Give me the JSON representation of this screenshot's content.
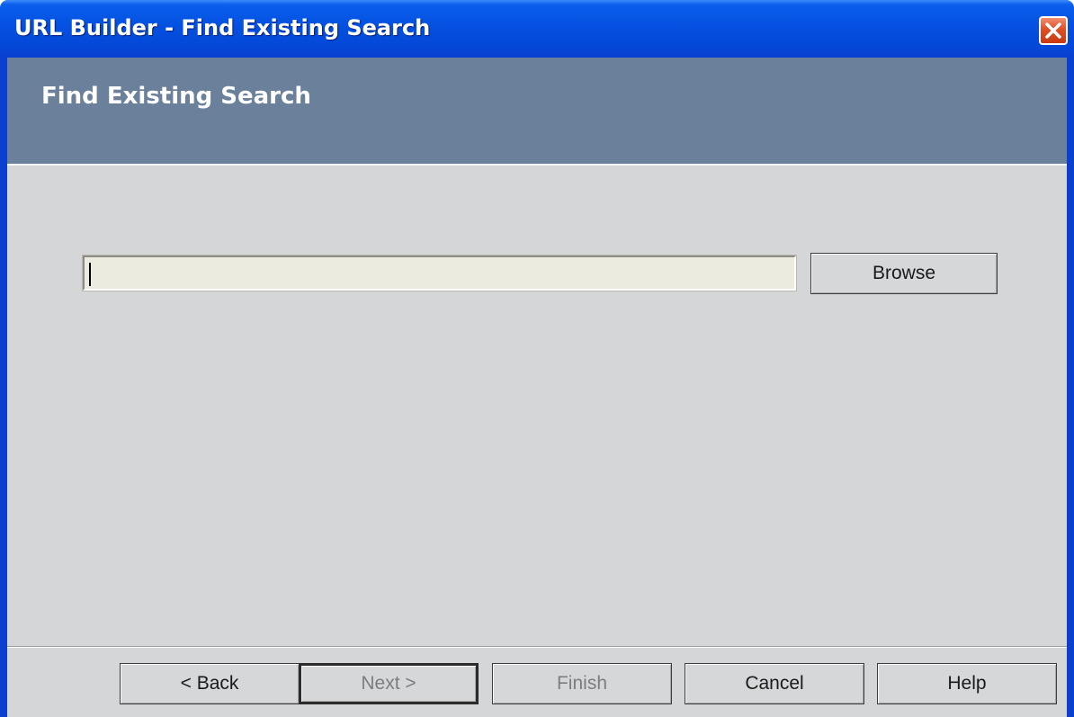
{
  "window": {
    "title": "URL Builder - Find Existing Search"
  },
  "banner": {
    "title": "Find Existing Search"
  },
  "form": {
    "search_path_value": "",
    "browse_label": "Browse"
  },
  "footer": {
    "back_label": "< Back",
    "next_label": "Next >",
    "finish_label": "Finish",
    "cancel_label": "Cancel",
    "help_label": "Help"
  },
  "icons": {
    "close": "close-icon"
  },
  "colors": {
    "banner": "#6b819b",
    "client": "#d4d6d8",
    "input_background": "#ecebdf",
    "titlebar": "#0550e0",
    "close_button": "#de4f24"
  }
}
